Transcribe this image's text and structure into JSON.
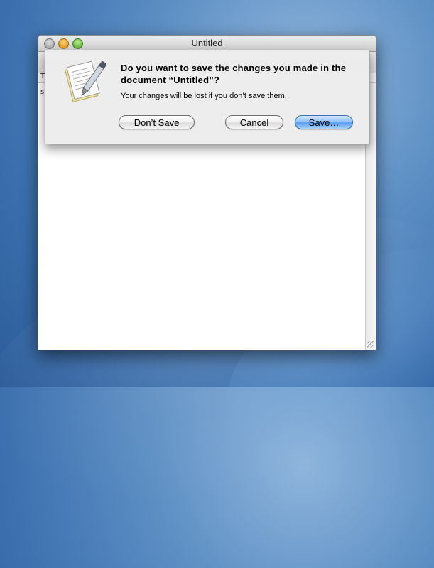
{
  "window": {
    "title": "Untitled",
    "ruler_mark": "T",
    "doc_text": "s"
  },
  "dialog": {
    "title": "Do you want to save the changes you made in the document “Untitled”?",
    "message": "Your changes will be lost if you don’t save them.",
    "buttons": {
      "dont_save": "Don’t Save",
      "cancel": "Cancel",
      "save": "Save…"
    },
    "icon": "textedit-document-pen-icon"
  },
  "colors": {
    "default_button": "#5a9df2",
    "close": "#9a9a9a",
    "minimize": "#e08a00",
    "zoom": "#4aa21f"
  }
}
